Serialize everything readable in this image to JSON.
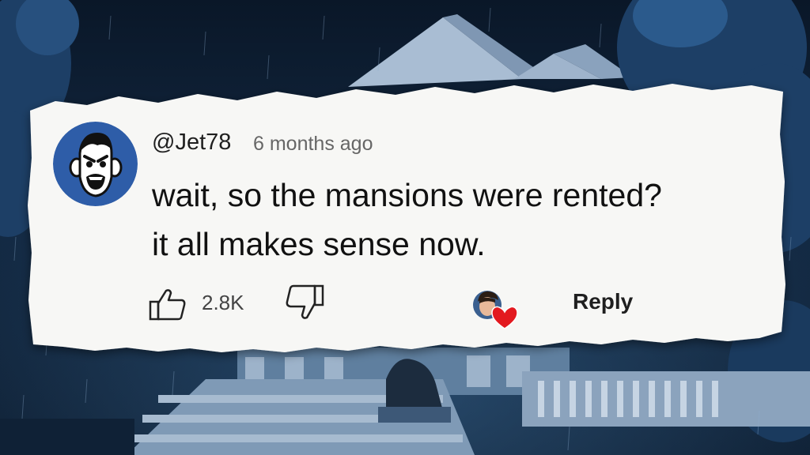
{
  "comment": {
    "author": "@Jet78",
    "time_ago": "6 months ago",
    "text_lines": [
      "wait, so the mansions were rented?",
      "it all makes sense now."
    ],
    "likes": "2.8K",
    "reply_label": "Reply"
  },
  "icons": {
    "like": "thumbs-up-icon",
    "dislike": "thumbs-down-icon",
    "creator_heart": "heart-icon"
  },
  "colors": {
    "avatar_bg": "#2e5da8",
    "heart": "#e3191f",
    "paper": "#f7f7f5"
  }
}
